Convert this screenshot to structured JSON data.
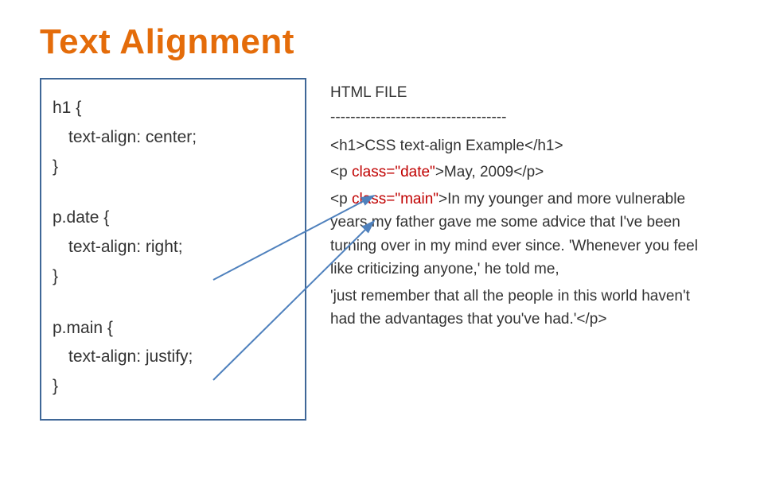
{
  "title": "Text Alignment",
  "css": {
    "h1_sel": "h1 {",
    "h1_rule": "text-align: center;",
    "h1_close": "}",
    "date_sel": "p.date {",
    "date_rule": "text-align: right;",
    "date_close": "}",
    "main_sel": "p.main {",
    "main_rule": "text-align: justify;",
    "main_close": "}"
  },
  "html": {
    "header": "HTML FILE",
    "separator": "-----------------------------------",
    "line1_open": "<h1>",
    "line1_text": "CSS text-align Example",
    "line1_close": "</h1>",
    "line2_open": "<p ",
    "line2_attr": "class=\"date\"",
    "line2_mid": ">",
    "line2_text": "May, 2009",
    "line2_close": "</p>",
    "line3_open": "<p ",
    "line3_attr": "class=\"main\"",
    "line3_mid": ">",
    "line3_text": "In my younger and more vulnerable years my father gave me some advice that I've been turning over in my mind ever since. 'Whenever you feel like criticizing anyone,' he told me,",
    "line4_text": "'just remember that all the people in this world haven't had the advantages that you've had.'",
    "line4_close": "</p>"
  }
}
